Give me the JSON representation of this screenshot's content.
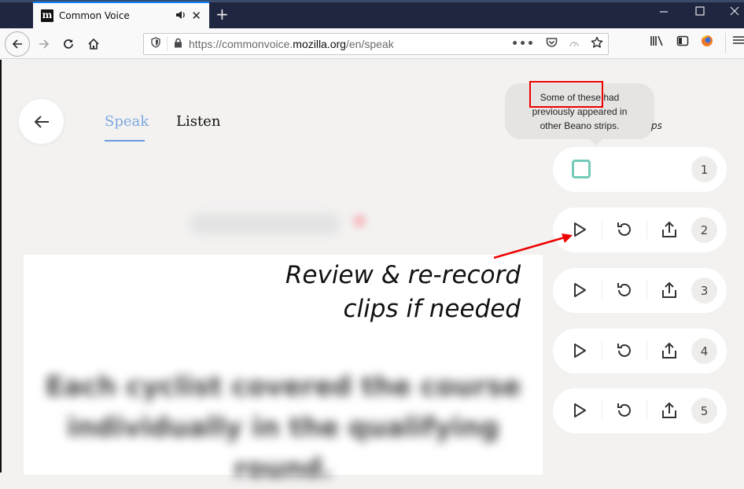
{
  "browser": {
    "tab_title": "Common Voice",
    "favicon_letter": "m",
    "new_tab_symbol": "+",
    "url_prefix": "https://commonvoice.",
    "url_domain": "mozilla.org",
    "url_path": "/en/speak",
    "window_controls": [
      "minimize",
      "maximize",
      "close"
    ]
  },
  "page": {
    "tabs": [
      {
        "label": "Speak",
        "active": true
      },
      {
        "label": "Listen",
        "active": false
      }
    ],
    "sentence": "Each cyclist covered the course individually in the qualifying round.",
    "tooltip_lines": [
      "Some of these had",
      "previously appeared in",
      "other Beano strips."
    ],
    "tooltip_tail": "ps",
    "annotation_lines": [
      "Review & re-record",
      "clips if needed"
    ],
    "clips": [
      {
        "number": "1",
        "state": "recording"
      },
      {
        "number": "2",
        "state": "recorded"
      },
      {
        "number": "3",
        "state": "recorded"
      },
      {
        "number": "4",
        "state": "recorded"
      },
      {
        "number": "5",
        "state": "recorded"
      }
    ],
    "colors": {
      "accent_blue": "#7da8df",
      "record_teal": "#74cbb9",
      "highlight_red": "#e00000"
    }
  }
}
